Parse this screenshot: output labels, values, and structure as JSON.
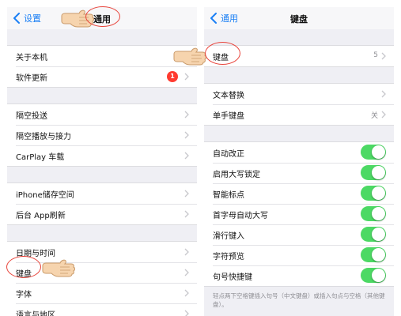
{
  "left": {
    "nav": {
      "back_label": "设置",
      "title": "通用"
    },
    "groups": [
      {
        "items": [
          {
            "label": "关于本机"
          },
          {
            "label": "软件更新",
            "badge": "1"
          }
        ]
      },
      {
        "items": [
          {
            "label": "隔空投送"
          },
          {
            "label": "隔空播放与接力"
          },
          {
            "label": "CarPlay 车载"
          }
        ]
      },
      {
        "items": [
          {
            "label": "iPhone储存空间"
          },
          {
            "label": "后台 App刷新"
          }
        ]
      },
      {
        "items": [
          {
            "label": "日期与时间"
          },
          {
            "label": "键盘"
          },
          {
            "label": "字体"
          },
          {
            "label": "语言与地区"
          }
        ]
      }
    ]
  },
  "right": {
    "nav": {
      "back_label": "通用",
      "title": "键盘"
    },
    "keyboards_row": {
      "label": "键盘",
      "value": "5"
    },
    "group2": [
      {
        "label": "文本替换"
      },
      {
        "label": "单手键盘",
        "value": "关"
      }
    ],
    "toggles": [
      {
        "label": "自动改正",
        "on": true
      },
      {
        "label": "启用大写锁定",
        "on": true
      },
      {
        "label": "智能标点",
        "on": true
      },
      {
        "label": "首字母自动大写",
        "on": true
      },
      {
        "label": "滑行键入",
        "on": true
      },
      {
        "label": "字符预览",
        "on": true
      },
      {
        "label": "句号快捷键",
        "on": true
      }
    ],
    "footer_note": "轻点两下空格键插入句号（中文键盘）或插入句点与空格（其他键盘）。"
  },
  "colors": {
    "accent": "#1a7ff5",
    "toggle_on": "#4cd964",
    "badge": "#ff3b30",
    "annotation": "#e8433a"
  }
}
